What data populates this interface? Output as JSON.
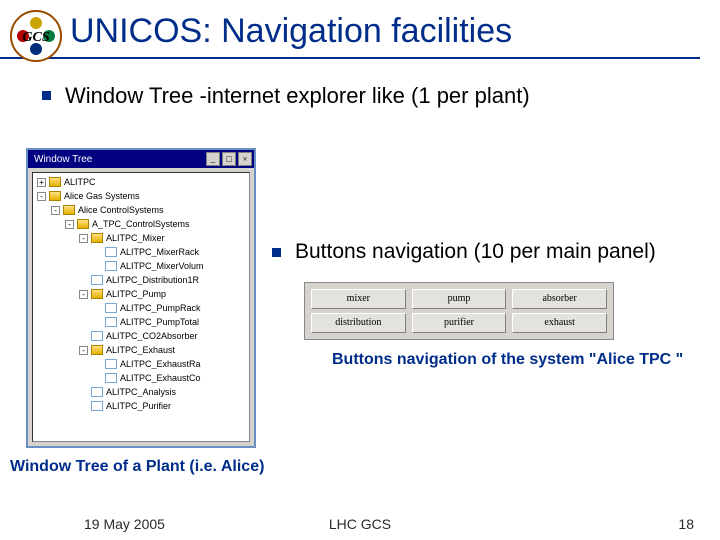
{
  "logo": {
    "text": "GCS"
  },
  "title": "UNICOS: Navigation facilities",
  "bullets": {
    "b1": "Window Tree -internet explorer like (1 per plant)",
    "b2": "Buttons navigation (10 per main panel)"
  },
  "treeWindow": {
    "title": "Window Tree",
    "btnMin": "_",
    "btnMax": "□",
    "btnClose": "×",
    "nodes": [
      {
        "depth": 0,
        "exp": "+",
        "icon": "folder",
        "label": "ALITPC"
      },
      {
        "depth": 0,
        "exp": "-",
        "icon": "folder",
        "label": "Alice Gas Systems"
      },
      {
        "depth": 1,
        "exp": "-",
        "icon": "folder",
        "label": "Alice ControlSystems"
      },
      {
        "depth": 2,
        "exp": "-",
        "icon": "folder",
        "label": "A_TPC_ControlSystems"
      },
      {
        "depth": 3,
        "exp": "-",
        "icon": "folder",
        "label": "ALITPC_Mixer"
      },
      {
        "depth": 4,
        "exp": "",
        "icon": "page",
        "label": "ALITPC_MixerRack"
      },
      {
        "depth": 4,
        "exp": "",
        "icon": "page",
        "label": "ALITPC_MixerVolum"
      },
      {
        "depth": 3,
        "exp": "",
        "icon": "page",
        "label": "ALITPC_Distribution1R"
      },
      {
        "depth": 3,
        "exp": "-",
        "icon": "folder",
        "label": "ALITPC_Pump"
      },
      {
        "depth": 4,
        "exp": "",
        "icon": "page",
        "label": "ALITPC_PumpRack"
      },
      {
        "depth": 4,
        "exp": "",
        "icon": "page",
        "label": "ALITPC_PumpTotal"
      },
      {
        "depth": 3,
        "exp": "",
        "icon": "page",
        "label": "ALITPC_CO2Absorber"
      },
      {
        "depth": 3,
        "exp": "-",
        "icon": "folder",
        "label": "ALITPC_Exhaust"
      },
      {
        "depth": 4,
        "exp": "",
        "icon": "page",
        "label": "ALITPC_ExhaustRa"
      },
      {
        "depth": 4,
        "exp": "",
        "icon": "page",
        "label": "ALITPC_ExhaustCo"
      },
      {
        "depth": 3,
        "exp": "",
        "icon": "page",
        "label": "ALITPC_Analysis"
      },
      {
        "depth": 3,
        "exp": "",
        "icon": "page",
        "label": "ALITPC_Purifier"
      }
    ]
  },
  "buttons": {
    "row1": [
      "mixer",
      "pump",
      "absorber"
    ],
    "row2": [
      "distribution",
      "purifier",
      "exhaust"
    ]
  },
  "buttonCaption": "Buttons navigation of the system \"Alice TPC \"",
  "treeCaption": "Window Tree of a Plant (i.e. Alice)",
  "footer": {
    "date": "19 May 2005",
    "center": "LHC GCS",
    "pageNumber": "18"
  }
}
